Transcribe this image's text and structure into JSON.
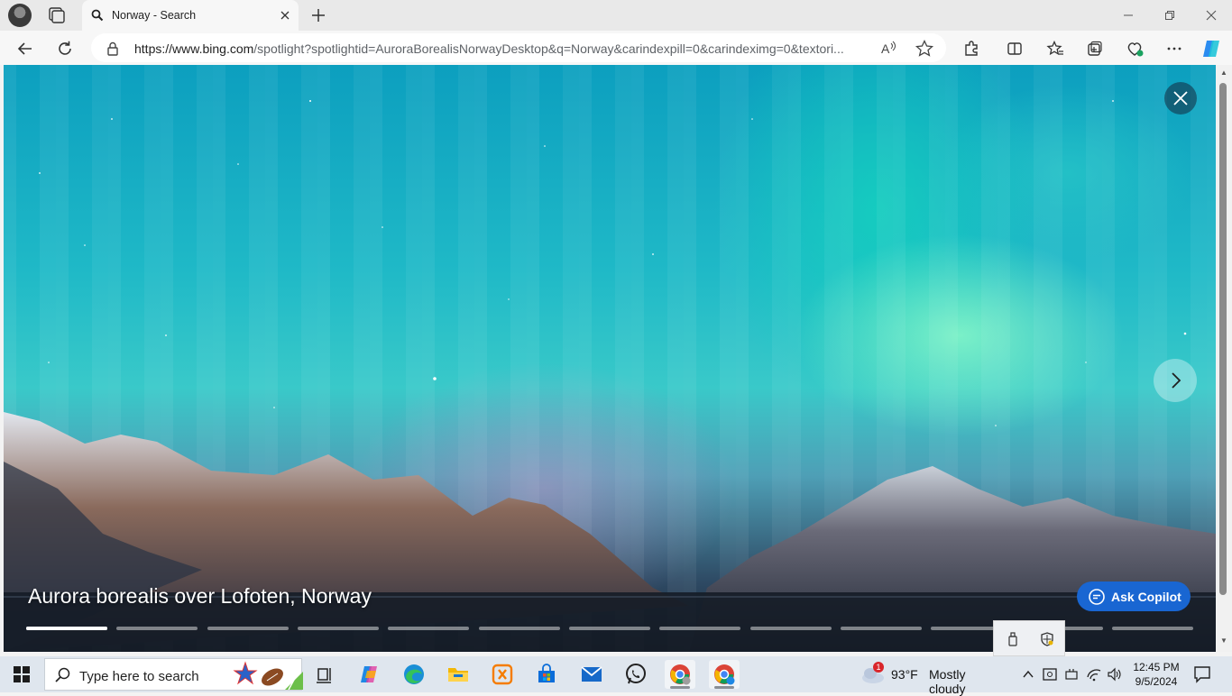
{
  "browser": {
    "tab": {
      "title": "Norway - Search"
    },
    "address": {
      "url_host": "https://www.bing.com",
      "url_rest": "/spotlight?spotlightid=AuroraBorealisNorwayDesktop&q=Norway&carindexpill=0&carindeximg=0&textori..."
    }
  },
  "spotlight": {
    "caption": "Aurora borealis over Lofoten, Norway",
    "ask_copilot_label": "Ask Copilot",
    "progress": {
      "segments": 13,
      "active_index": 0,
      "active_fill": 1.0
    },
    "accent": "#1966d2"
  },
  "taskbar": {
    "search_placeholder": "Type here to search",
    "weather": {
      "temp": "93°F",
      "condition": "Mostly cloudy",
      "badge": "1"
    },
    "clock": {
      "time": "12:45 PM",
      "date": "9/5/2024"
    }
  }
}
